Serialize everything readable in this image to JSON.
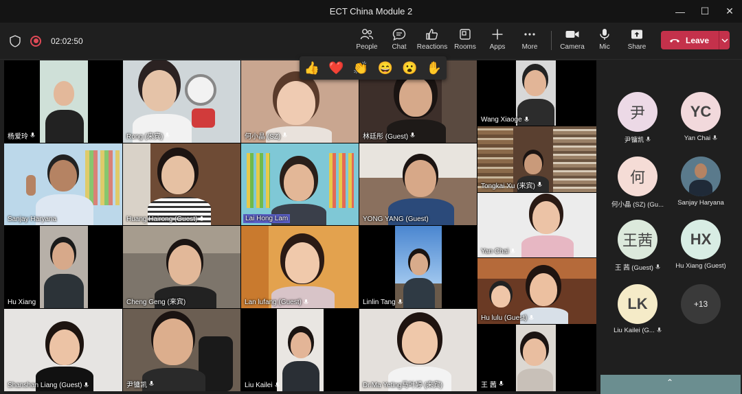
{
  "window": {
    "title": "ECT China Module 2"
  },
  "toolbar": {
    "timer": "02:02:50",
    "buttons": [
      {
        "label": "People",
        "icon": "people-icon"
      },
      {
        "label": "Chat",
        "icon": "chat-icon"
      },
      {
        "label": "Reactions",
        "icon": "reactions-icon"
      },
      {
        "label": "Rooms",
        "icon": "rooms-icon"
      },
      {
        "label": "Apps",
        "icon": "apps-icon"
      },
      {
        "label": "More",
        "icon": "more-icon"
      },
      {
        "label": "Camera",
        "icon": "camera-icon"
      },
      {
        "label": "Mic",
        "icon": "mic-icon"
      },
      {
        "label": "Share",
        "icon": "share-icon"
      }
    ],
    "leave_label": "Leave"
  },
  "reactions": [
    "👍",
    "❤️",
    "👏",
    "😄",
    "😮",
    "✋"
  ],
  "grid": {
    "tiles": [
      {
        "name": "杨爱玲"
      },
      {
        "name": "Rong (来宾)"
      },
      {
        "name": "何小晶 (SZ)"
      },
      {
        "name": "林廷彤 (Guest)"
      },
      {
        "name": "Wang Xiaoge"
      },
      {
        "name": "Sanjay Haryana"
      },
      {
        "name": "Huang Hairong (Guest)"
      },
      {
        "name": "Lai Hong Lam"
      },
      {
        "name": "YONG YANG (Guest)"
      },
      {
        "name": "Tongkai Xu (来宾)"
      },
      {
        "name": "Hu Xiang"
      },
      {
        "name": "Cheng Geng (来宾)"
      },
      {
        "name": "Lan lufang (Guest)"
      },
      {
        "name": "Linlin Tang"
      },
      {
        "name": "Yan Chai"
      },
      {
        "name": "Shanshan Liang (Guest)"
      },
      {
        "name": "尹镛凯"
      },
      {
        "name": "Liu Kailei"
      },
      {
        "name": "Dr.Ma Yeting马叶婷 (来宾)"
      },
      {
        "name": "Hu lulu (Guest)"
      },
      {
        "name": "王 茜"
      }
    ]
  },
  "panel": {
    "participants": [
      {
        "initials": "尹",
        "name": "尹镛凯",
        "bg": "#ecd9e6"
      },
      {
        "initials": "YC",
        "name": "Yan Chai",
        "bg": "#f2d9dc"
      },
      {
        "initials": "何",
        "name": "何小晶 (SZ) (Gu...",
        "bg": "#f5dcd6"
      },
      {
        "initials": "",
        "name": "Sanjay Haryana",
        "bg": "#5a7a8c"
      },
      {
        "initials": "王茜",
        "name": "王 茜 (Guest)",
        "bg": "#dce9dc"
      },
      {
        "initials": "HX",
        "name": "Hu Xiang (Guest)",
        "bg": "#d8ede4"
      },
      {
        "initials": "LK",
        "name": "Liu Kailei (G...",
        "bg": "#f5ebc8"
      }
    ],
    "more_count": "+13"
  }
}
